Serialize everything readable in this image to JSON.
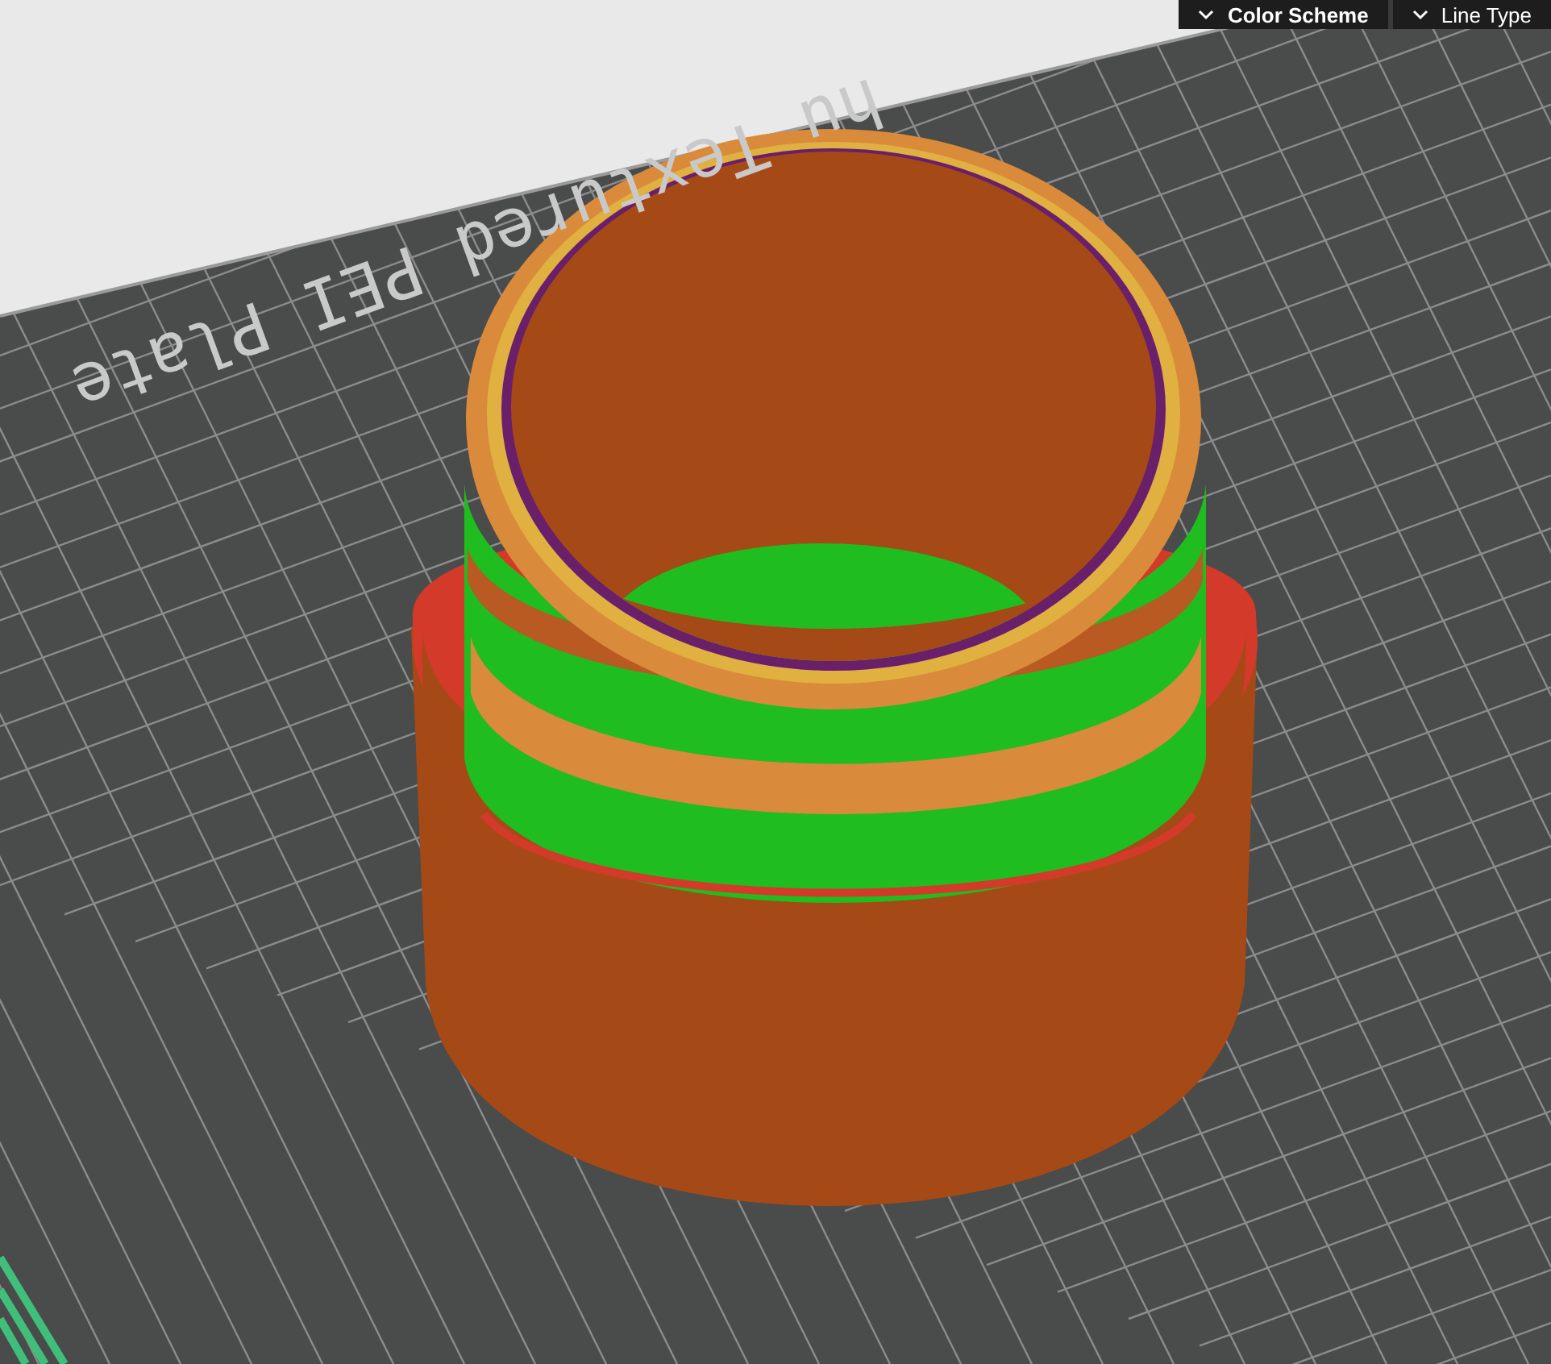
{
  "view_toolbar": {
    "dropdowns": [
      {
        "label": "Color Scheme",
        "emphasis": true
      },
      {
        "label": "Line Type",
        "emphasis": false
      }
    ]
  },
  "plate": {
    "label": "hu Textured PEI Plate"
  }
}
